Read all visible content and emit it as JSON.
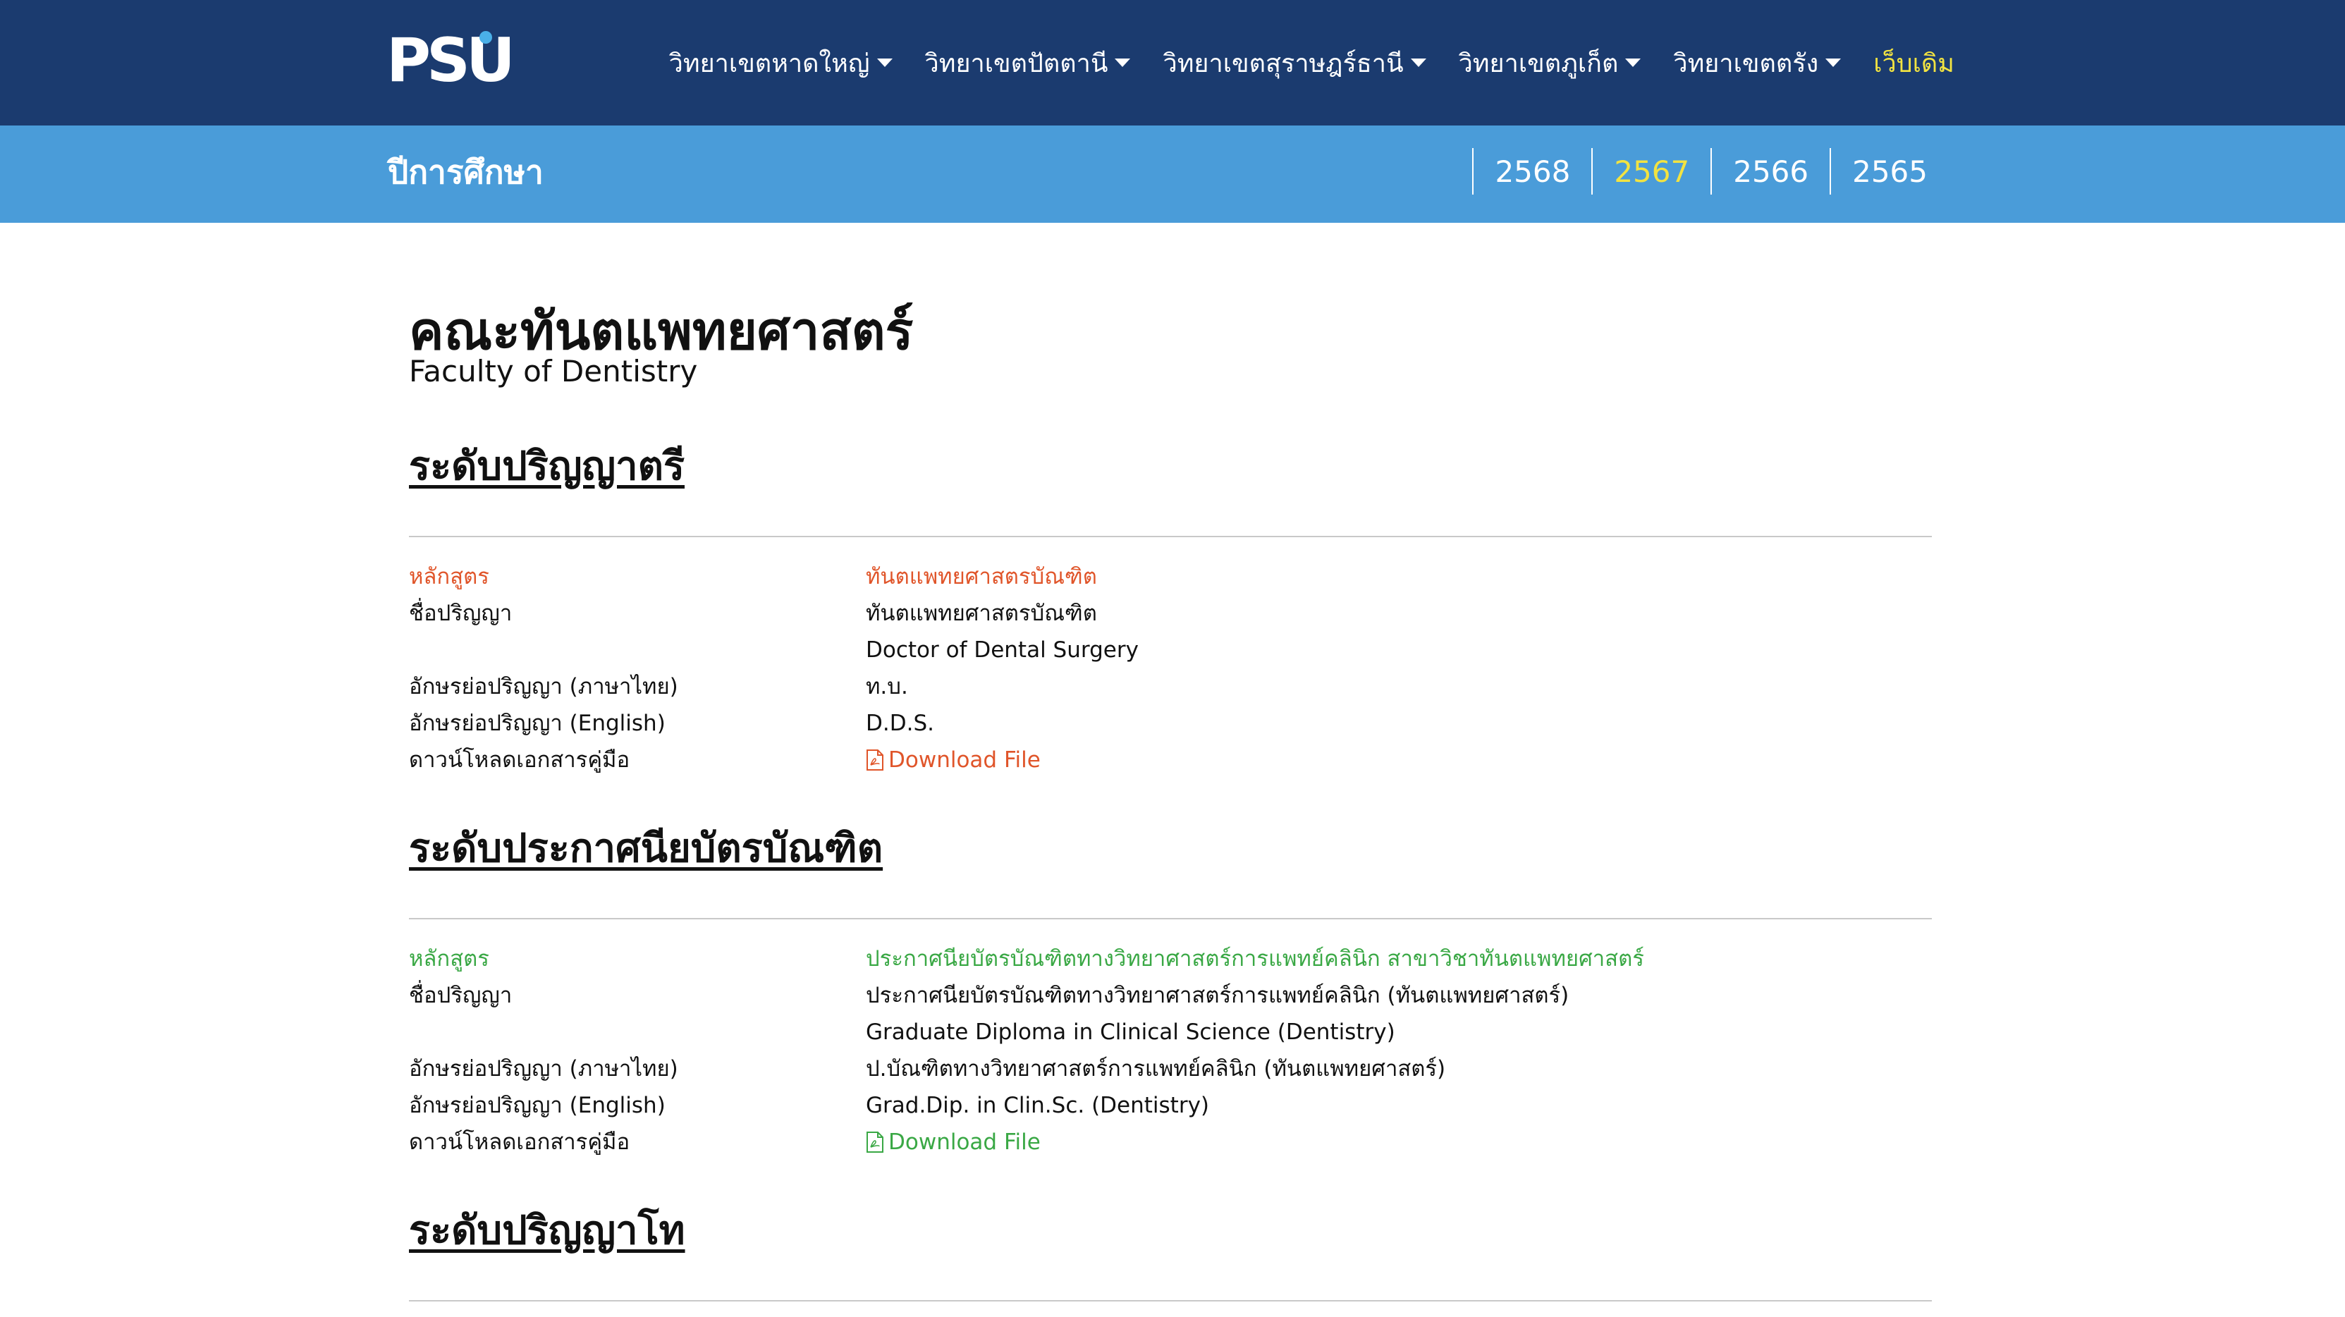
{
  "nav": {
    "logo_text": "PSU",
    "items": [
      {
        "label": "วิทยาเขตหาดใหญ่"
      },
      {
        "label": "วิทยาเขตปัตตานี"
      },
      {
        "label": "วิทยาเขตสุราษฎร์ธานี"
      },
      {
        "label": "วิทยาเขตภูเก็ต"
      },
      {
        "label": "วิทยาเขตตรัง"
      }
    ],
    "legacy_label": "เว็บเดิม"
  },
  "yearbar": {
    "title": "ปีการศึกษา",
    "years": [
      "2568",
      "2567",
      "2566",
      "2565"
    ],
    "active_year": "2567"
  },
  "faculty": {
    "name_th": "คณะทันตแพทยศาสตร์",
    "name_en": "Faculty of Dentistry"
  },
  "labels": {
    "program": "หลักสูตร",
    "degree_name": "ชื่อปริญญา",
    "abbr_th": "อักษรย่อปริญญา (ภาษาไทย)",
    "abbr_en": "อักษรย่อปริญญา (English)",
    "download": "ดาวน์โหลดเอกสารคู่มือ",
    "download_link": "Download File"
  },
  "levels": [
    {
      "heading": "ระดับปริญญาตรี",
      "program": {
        "title": "ทันตแพทยศาสตรบัณฑิต",
        "degree_th": "ทันตแพทยศาสตรบัณฑิต",
        "degree_en": "Doctor of Dental Surgery",
        "abbr_th": "ท.บ.",
        "abbr_en": "D.D.S."
      }
    },
    {
      "heading": "ระดับประกาศนียบัตรบัณฑิต",
      "program": {
        "title": "ประกาศนียบัตรบัณฑิตทางวิทยาศาสตร์การแพทย์คลินิก สาขาวิชาทันตแพทยศาสตร์",
        "degree_th": "ประกาศนียบัตรบัณฑิตทางวิทยาศาสตร์การแพทย์คลินิก (ทันตแพทยศาสตร์)",
        "degree_en": "Graduate Diploma in Clinical Science (Dentistry)",
        "abbr_th": "ป.บัณฑิตทางวิทยาศาสตร์การแพทย์คลินิก (ทันตแพทยศาสตร์)",
        "abbr_en": "Grad.Dip. in Clin.Sc. (Dentistry)"
      }
    },
    {
      "heading": "ระดับปริญญาโท"
    }
  ],
  "colors": {
    "nav_bg": "#1b3b6f",
    "yearbar_bg": "#4a9cd9",
    "active_year": "#f2e341",
    "bachelor_accent": "#e0552a",
    "graddip_accent": "#3aa845"
  }
}
